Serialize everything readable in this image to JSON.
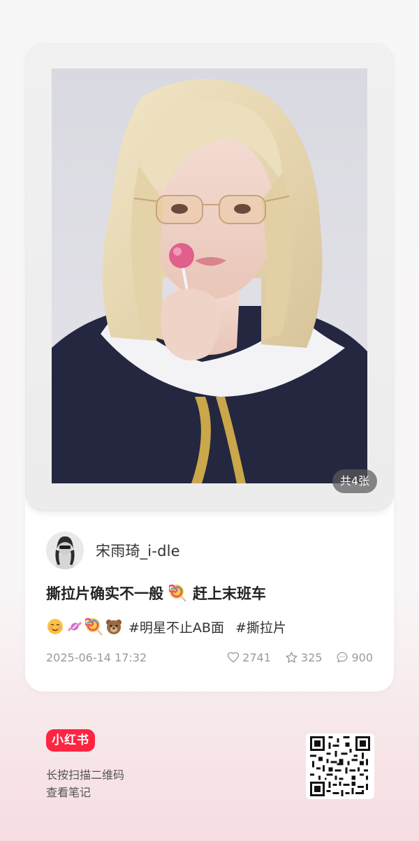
{
  "note": {
    "image_count_label": "共4张",
    "author": {
      "name": "宋雨琦_i-dle"
    },
    "title_part1": "撕拉片确实不一般",
    "title_part2": "赶上末班车",
    "title_emoji": "lollipop-icon",
    "tag_emojis": [
      "smiling-face-icon",
      "candy-icon",
      "lollipop-icon",
      "bear-face-icon"
    ],
    "tags": [
      "#明星不止AB面",
      "#撕拉片"
    ],
    "date": "2025-06-14 17:32",
    "stats": {
      "likes": "2741",
      "favorites": "325",
      "comments": "900"
    }
  },
  "footer": {
    "logo_text": "小红书",
    "hint_line1": "长按扫描二维码",
    "hint_line2": "查看笔记"
  },
  "colors": {
    "brand": "#ff2442",
    "meta_text": "#9a9a9a"
  }
}
